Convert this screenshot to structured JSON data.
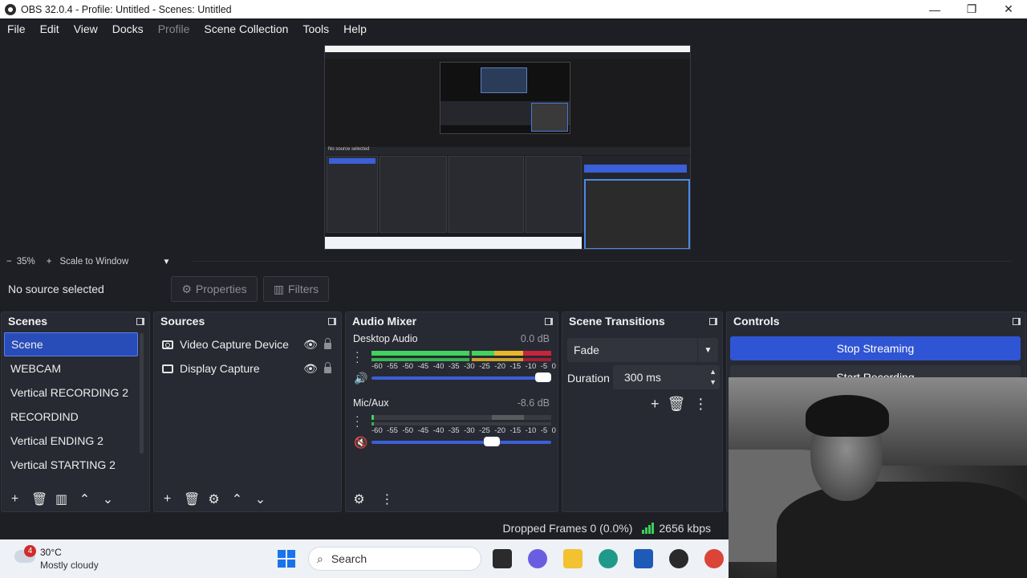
{
  "window": {
    "title": "OBS 32.0.4 - Profile: Untitled - Scenes: Untitled",
    "minimize": "—",
    "maximize": "❐",
    "close": "✕"
  },
  "menu": [
    "File",
    "Edit",
    "View",
    "Docks",
    "Profile",
    "Scene Collection",
    "Tools",
    "Help"
  ],
  "zoom": {
    "minus": "−",
    "level": "35%",
    "plus": "+",
    "scale_mode": "Scale to Window"
  },
  "context": {
    "no_source": "No source selected",
    "properties": "Properties",
    "filters": "Filters"
  },
  "scenes": {
    "title": "Scenes",
    "items": [
      "Scene",
      "WEBCAM",
      "Vertical RECORDING 2",
      "RECORDIND",
      "Vertical ENDING 2",
      "Vertical STARTING 2"
    ],
    "selected_index": 0
  },
  "sources": {
    "title": "Sources",
    "items": [
      {
        "name": "Video Capture Device",
        "icon": "camera-icon"
      },
      {
        "name": "Display Capture",
        "icon": "monitor-icon"
      }
    ]
  },
  "mixer": {
    "title": "Audio Mixer",
    "scale_labels": [
      "-60",
      "-55",
      "-50",
      "-45",
      "-40",
      "-35",
      "-30",
      "-25",
      "-20",
      "-15",
      "-10",
      "-5",
      "0"
    ],
    "channels": [
      {
        "name": "Desktop Audio",
        "db": "0.0 dB",
        "muted": false,
        "volume": 1.0
      },
      {
        "name": "Mic/Aux",
        "db": "-8.6 dB",
        "muted": true,
        "volume": 0.67
      }
    ]
  },
  "transitions": {
    "title": "Scene Transitions",
    "selected": "Fade",
    "duration_label": "Duration",
    "duration_value": "300 ms"
  },
  "controls": {
    "title": "Controls",
    "stop_streaming": "Stop Streaming",
    "start_recording": "Start Recording",
    "accent": "#2f55d4"
  },
  "status": {
    "dropped_frames": "Dropped Frames 0 (0.0%)",
    "bitrate": "2656 kbps"
  },
  "taskbar": {
    "weather_badge": "4",
    "temperature": "30°C",
    "condition": "Mostly cloudy",
    "search_placeholder": "Search"
  },
  "nested_preview": {
    "status_text": "No source selected"
  }
}
